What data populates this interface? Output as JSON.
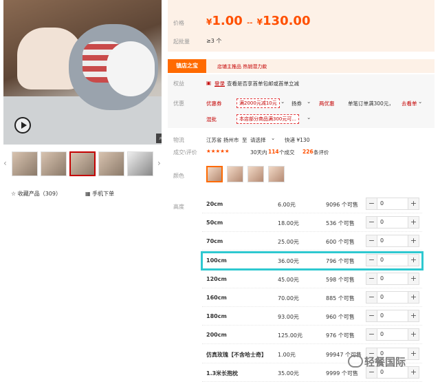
{
  "gallery": {
    "zoom_icon": "magnifier-icon",
    "play_icon": "play-icon",
    "prev_icon": "‹",
    "next_icon": "›"
  },
  "favorites": {
    "icon": "☆",
    "label": "收藏产品（309）"
  },
  "mobile_order": {
    "icon": "▦",
    "label": "手机下单"
  },
  "price": {
    "label": "价格",
    "yen": "¥",
    "low": "1.00",
    "sep": "--",
    "high": "130.00",
    "moq_label": "起批量",
    "moq_value": "≥3 个"
  },
  "store": {
    "badge": "镇店之宝",
    "text": "店铺主推品  热销潜力款"
  },
  "benefits": {
    "rights_label": "权益",
    "rights_icon": "▣",
    "rights_tag": "登录",
    "rights_text": "查看是否享首单包邮或首单立减",
    "promo_label": "优惠",
    "coupon_label": "优惠券",
    "coupon_tag": "满2000元减10元",
    "coupon_more": "⌄",
    "gold_coupon": "扬券",
    "gold_more": "⌄",
    "mix_label": "两优惠",
    "mix_text": "单笔订单满300元，",
    "mix_link": "去看单",
    "mix_more": "⌄",
    "mixbatch_label": "混批",
    "mixbatch_tag": "本店部分商品满300元可...",
    "mixbatch_more": "⌄"
  },
  "logistics": {
    "label": "物流",
    "origin": "江苏省 扬州市",
    "to": "至",
    "dest": "请选择",
    "dest_more": "⌄",
    "express": "快递 ¥130"
  },
  "reviews": {
    "label": "成交\\评价",
    "stars": "★★★★★",
    "days": "30天内",
    "deals": "114",
    "deals_suffix": "个成交",
    "count": "226",
    "count_suffix": "条评价"
  },
  "colors": {
    "label": "颜色"
  },
  "sizes": {
    "label": "高度",
    "rows": [
      {
        "name": "20cm",
        "price": "6.00元",
        "stock": "9096 个可售",
        "qty": "0"
      },
      {
        "name": "50cm",
        "price": "18.00元",
        "stock": "536 个可售",
        "qty": "0"
      },
      {
        "name": "70cm",
        "price": "25.00元",
        "stock": "600 个可售",
        "qty": "0"
      },
      {
        "name": "100cm",
        "price": "36.00元",
        "stock": "796 个可售",
        "qty": "0"
      },
      {
        "name": "120cm",
        "price": "45.00元",
        "stock": "598 个可售",
        "qty": "0"
      },
      {
        "name": "160cm",
        "price": "70.00元",
        "stock": "885 个可售",
        "qty": "0"
      },
      {
        "name": "180cm",
        "price": "93.00元",
        "stock": "960 个可售",
        "qty": "0"
      },
      {
        "name": "200cm",
        "price": "125.00元",
        "stock": "976 个可售",
        "qty": "0"
      },
      {
        "name": "仿真玫瑰【不含哈士奇】",
        "price": "1.00元",
        "stock": "99947 个可售",
        "qty": "0"
      },
      {
        "name": "1.3米长抱枕",
        "price": "35.00元",
        "stock": "9999 个可售",
        "qty": "0"
      }
    ]
  },
  "watermark": "轻餐国际",
  "accent": "#ff5000",
  "highlight_color": "#2ec8d0"
}
